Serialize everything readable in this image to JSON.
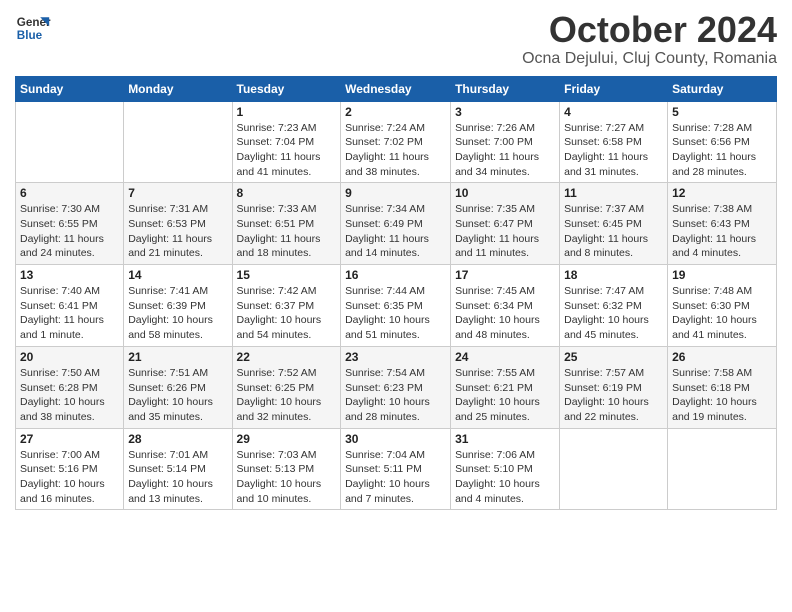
{
  "logo": {
    "line1": "General",
    "line2": "Blue"
  },
  "title": "October 2024",
  "location": "Ocna Dejului, Cluj County, Romania",
  "days_of_week": [
    "Sunday",
    "Monday",
    "Tuesday",
    "Wednesday",
    "Thursday",
    "Friday",
    "Saturday"
  ],
  "weeks": [
    [
      {
        "day": null
      },
      {
        "day": null
      },
      {
        "day": "1",
        "sunrise": "Sunrise: 7:23 AM",
        "sunset": "Sunset: 7:04 PM",
        "daylight": "Daylight: 11 hours and 41 minutes."
      },
      {
        "day": "2",
        "sunrise": "Sunrise: 7:24 AM",
        "sunset": "Sunset: 7:02 PM",
        "daylight": "Daylight: 11 hours and 38 minutes."
      },
      {
        "day": "3",
        "sunrise": "Sunrise: 7:26 AM",
        "sunset": "Sunset: 7:00 PM",
        "daylight": "Daylight: 11 hours and 34 minutes."
      },
      {
        "day": "4",
        "sunrise": "Sunrise: 7:27 AM",
        "sunset": "Sunset: 6:58 PM",
        "daylight": "Daylight: 11 hours and 31 minutes."
      },
      {
        "day": "5",
        "sunrise": "Sunrise: 7:28 AM",
        "sunset": "Sunset: 6:56 PM",
        "daylight": "Daylight: 11 hours and 28 minutes."
      }
    ],
    [
      {
        "day": "6",
        "sunrise": "Sunrise: 7:30 AM",
        "sunset": "Sunset: 6:55 PM",
        "daylight": "Daylight: 11 hours and 24 minutes."
      },
      {
        "day": "7",
        "sunrise": "Sunrise: 7:31 AM",
        "sunset": "Sunset: 6:53 PM",
        "daylight": "Daylight: 11 hours and 21 minutes."
      },
      {
        "day": "8",
        "sunrise": "Sunrise: 7:33 AM",
        "sunset": "Sunset: 6:51 PM",
        "daylight": "Daylight: 11 hours and 18 minutes."
      },
      {
        "day": "9",
        "sunrise": "Sunrise: 7:34 AM",
        "sunset": "Sunset: 6:49 PM",
        "daylight": "Daylight: 11 hours and 14 minutes."
      },
      {
        "day": "10",
        "sunrise": "Sunrise: 7:35 AM",
        "sunset": "Sunset: 6:47 PM",
        "daylight": "Daylight: 11 hours and 11 minutes."
      },
      {
        "day": "11",
        "sunrise": "Sunrise: 7:37 AM",
        "sunset": "Sunset: 6:45 PM",
        "daylight": "Daylight: 11 hours and 8 minutes."
      },
      {
        "day": "12",
        "sunrise": "Sunrise: 7:38 AM",
        "sunset": "Sunset: 6:43 PM",
        "daylight": "Daylight: 11 hours and 4 minutes."
      }
    ],
    [
      {
        "day": "13",
        "sunrise": "Sunrise: 7:40 AM",
        "sunset": "Sunset: 6:41 PM",
        "daylight": "Daylight: 11 hours and 1 minute."
      },
      {
        "day": "14",
        "sunrise": "Sunrise: 7:41 AM",
        "sunset": "Sunset: 6:39 PM",
        "daylight": "Daylight: 10 hours and 58 minutes."
      },
      {
        "day": "15",
        "sunrise": "Sunrise: 7:42 AM",
        "sunset": "Sunset: 6:37 PM",
        "daylight": "Daylight: 10 hours and 54 minutes."
      },
      {
        "day": "16",
        "sunrise": "Sunrise: 7:44 AM",
        "sunset": "Sunset: 6:35 PM",
        "daylight": "Daylight: 10 hours and 51 minutes."
      },
      {
        "day": "17",
        "sunrise": "Sunrise: 7:45 AM",
        "sunset": "Sunset: 6:34 PM",
        "daylight": "Daylight: 10 hours and 48 minutes."
      },
      {
        "day": "18",
        "sunrise": "Sunrise: 7:47 AM",
        "sunset": "Sunset: 6:32 PM",
        "daylight": "Daylight: 10 hours and 45 minutes."
      },
      {
        "day": "19",
        "sunrise": "Sunrise: 7:48 AM",
        "sunset": "Sunset: 6:30 PM",
        "daylight": "Daylight: 10 hours and 41 minutes."
      }
    ],
    [
      {
        "day": "20",
        "sunrise": "Sunrise: 7:50 AM",
        "sunset": "Sunset: 6:28 PM",
        "daylight": "Daylight: 10 hours and 38 minutes."
      },
      {
        "day": "21",
        "sunrise": "Sunrise: 7:51 AM",
        "sunset": "Sunset: 6:26 PM",
        "daylight": "Daylight: 10 hours and 35 minutes."
      },
      {
        "day": "22",
        "sunrise": "Sunrise: 7:52 AM",
        "sunset": "Sunset: 6:25 PM",
        "daylight": "Daylight: 10 hours and 32 minutes."
      },
      {
        "day": "23",
        "sunrise": "Sunrise: 7:54 AM",
        "sunset": "Sunset: 6:23 PM",
        "daylight": "Daylight: 10 hours and 28 minutes."
      },
      {
        "day": "24",
        "sunrise": "Sunrise: 7:55 AM",
        "sunset": "Sunset: 6:21 PM",
        "daylight": "Daylight: 10 hours and 25 minutes."
      },
      {
        "day": "25",
        "sunrise": "Sunrise: 7:57 AM",
        "sunset": "Sunset: 6:19 PM",
        "daylight": "Daylight: 10 hours and 22 minutes."
      },
      {
        "day": "26",
        "sunrise": "Sunrise: 7:58 AM",
        "sunset": "Sunset: 6:18 PM",
        "daylight": "Daylight: 10 hours and 19 minutes."
      }
    ],
    [
      {
        "day": "27",
        "sunrise": "Sunrise: 7:00 AM",
        "sunset": "Sunset: 5:16 PM",
        "daylight": "Daylight: 10 hours and 16 minutes."
      },
      {
        "day": "28",
        "sunrise": "Sunrise: 7:01 AM",
        "sunset": "Sunset: 5:14 PM",
        "daylight": "Daylight: 10 hours and 13 minutes."
      },
      {
        "day": "29",
        "sunrise": "Sunrise: 7:03 AM",
        "sunset": "Sunset: 5:13 PM",
        "daylight": "Daylight: 10 hours and 10 minutes."
      },
      {
        "day": "30",
        "sunrise": "Sunrise: 7:04 AM",
        "sunset": "Sunset: 5:11 PM",
        "daylight": "Daylight: 10 hours and 7 minutes."
      },
      {
        "day": "31",
        "sunrise": "Sunrise: 7:06 AM",
        "sunset": "Sunset: 5:10 PM",
        "daylight": "Daylight: 10 hours and 4 minutes."
      },
      {
        "day": null
      },
      {
        "day": null
      }
    ]
  ]
}
